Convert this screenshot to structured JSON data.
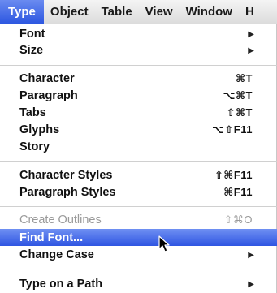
{
  "menubar": {
    "items": [
      {
        "label": "Type",
        "active": true
      },
      {
        "label": "Object"
      },
      {
        "label": "Table"
      },
      {
        "label": "View"
      },
      {
        "label": "Window"
      },
      {
        "label": "H"
      }
    ]
  },
  "menu": {
    "items": [
      {
        "label": "Font",
        "submenu": true
      },
      {
        "label": "Size",
        "submenu": true
      },
      {
        "label": "Character",
        "shortcut": "⌘T"
      },
      {
        "label": "Paragraph",
        "shortcut": "⌥⌘T"
      },
      {
        "label": "Tabs",
        "shortcut": "⇧⌘T"
      },
      {
        "label": "Glyphs",
        "shortcut": "⌥⇧F11"
      },
      {
        "label": "Story"
      },
      {
        "label": "Character Styles",
        "shortcut": "⇧⌘F11"
      },
      {
        "label": "Paragraph Styles",
        "shortcut": "⌘F11"
      },
      {
        "label": "Create Outlines",
        "shortcut": "⇧⌘O",
        "disabled": true
      },
      {
        "label": "Find Font...",
        "highlighted": true
      },
      {
        "label": "Change Case",
        "submenu": true
      },
      {
        "label": "Type on a Path",
        "submenu": true
      }
    ]
  },
  "colors": {
    "highlight": "#2f56e2",
    "disabled_text": "#9a9a9a"
  },
  "icons": {
    "submenu": "submenu-arrow-icon",
    "cursor": "mouse-pointer-icon"
  }
}
